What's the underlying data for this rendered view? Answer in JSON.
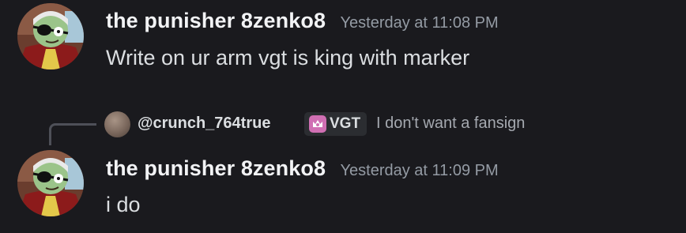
{
  "messages": [
    {
      "username": "the punisher 8zenko8",
      "timestamp": "Yesterday at 11:08 PM",
      "content": "Write on ur arm vgt is king with marker"
    },
    {
      "reply": {
        "username": "@crunch_764true",
        "tag": "VGT",
        "text": "I don't want a fansign"
      },
      "username": "the punisher 8zenko8",
      "timestamp": "Yesterday at 11:09 PM",
      "content": "i do"
    }
  ],
  "colors": {
    "background": "#1a1a1e",
    "username": "#f2f3f5",
    "timestamp": "#949ba4",
    "tag_icon": "#d06fb3"
  }
}
